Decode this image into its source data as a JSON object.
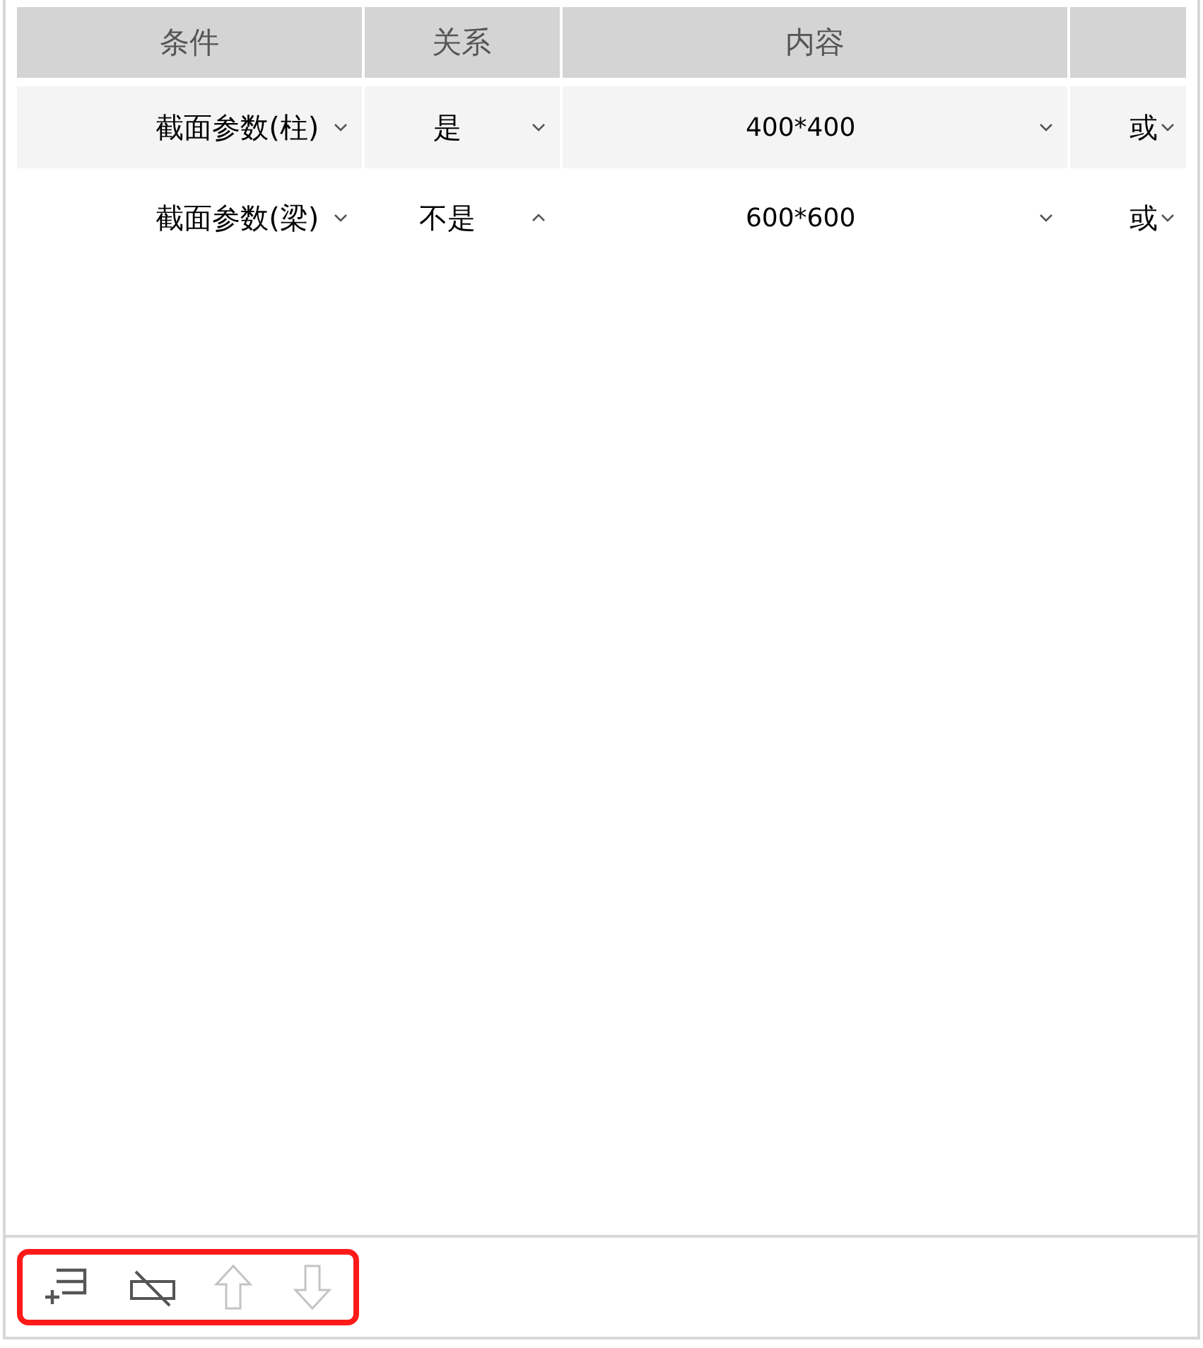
{
  "table": {
    "columns": [
      "条件",
      "关系",
      "内容"
    ],
    "rows": [
      {
        "cells": [
          {
            "value": "截面参数(柱)",
            "expanded": false
          },
          {
            "value": "是",
            "expanded": false
          },
          {
            "value": "400*400",
            "expanded": false
          },
          {
            "value": "或",
            "expanded": false
          }
        ]
      },
      {
        "cells": [
          {
            "value": "截面参数(梁)",
            "expanded": false
          },
          {
            "value": "不是",
            "expanded": true
          },
          {
            "value": "600*600",
            "expanded": false
          },
          {
            "value": "或",
            "expanded": false
          }
        ]
      }
    ]
  },
  "toolbar": {
    "highlighted": true,
    "buttons": [
      {
        "kind": "add-row",
        "disabled": false
      },
      {
        "kind": "delete-row",
        "disabled": false
      },
      {
        "kind": "move-up",
        "disabled": true
      },
      {
        "kind": "move-down",
        "disabled": true
      }
    ]
  }
}
